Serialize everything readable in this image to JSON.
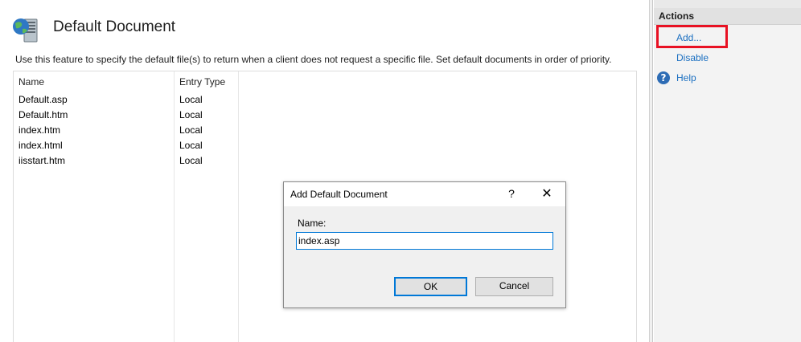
{
  "page": {
    "title": "Default Document",
    "description": "Use this feature to specify the default file(s) to return when a client does not request a specific file. Set default documents in order of priority."
  },
  "list": {
    "columns": [
      "Name",
      "Entry Type"
    ],
    "rows": [
      {
        "name": "Default.asp",
        "entry_type": "Local"
      },
      {
        "name": "Default.htm",
        "entry_type": "Local"
      },
      {
        "name": "index.htm",
        "entry_type": "Local"
      },
      {
        "name": "index.html",
        "entry_type": "Local"
      },
      {
        "name": "iisstart.htm",
        "entry_type": "Local"
      }
    ]
  },
  "actions": {
    "title": "Actions",
    "items": [
      "Add...",
      "Disable",
      "Help"
    ],
    "highlight_color": "#e81123",
    "link_color": "#1a6fc1"
  },
  "dialog": {
    "title": "Add Default Document",
    "help_glyph": "?",
    "close_glyph": "✕",
    "name_label": "Name:",
    "name_value": "index.asp",
    "ok_label": "OK",
    "cancel_label": "Cancel"
  }
}
